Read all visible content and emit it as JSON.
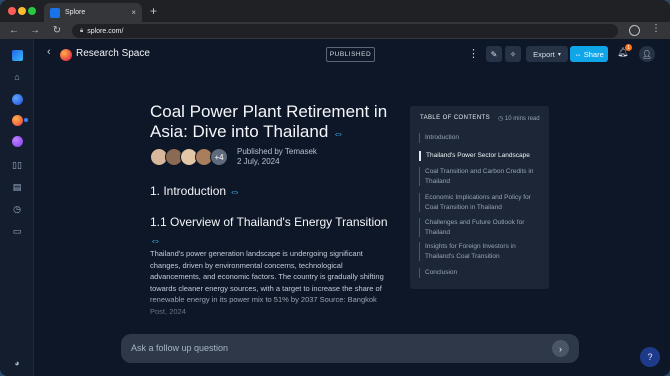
{
  "browser": {
    "tab_title": "Splore",
    "tab_close": "×",
    "new_tab": "+",
    "url": "splore.com/"
  },
  "topbar": {
    "back_icon": "‹",
    "space_title": "Research Space",
    "status": "PUBLISHED",
    "more_icon": "⋮",
    "export_label": "Export",
    "share_label": "Share",
    "notification_count": "1"
  },
  "article": {
    "title": "Coal Power Plant Retirement in Asia: Dive into Thailand",
    "published_by": "Published by Temasek",
    "date": "2 July, 2024",
    "extra_authors": "+4",
    "h2": "1. Introduction",
    "h3": "1.1 Overview of Thailand's Energy Transition",
    "body": "Thailand's power generation landscape is undergoing significant changes, driven by environmental concerns, technological advancements, and economic factors. The country is gradually shifting towards cleaner energy sources, with a target to increase the share of renewable energy in its power mix to 51% by 2037 Source: Bangkok Post, 2024"
  },
  "toc": {
    "heading": "TABLE OF CONTENTS",
    "read_time": "10 mins read",
    "items": [
      {
        "label": "Introduction"
      },
      {
        "label": "Thailand's Power Sector Landscape"
      },
      {
        "label": "Coal Transition and Carbon Credits in Thailand"
      },
      {
        "label": "Economic Implications and Policy for Coal Transition in Thailand"
      },
      {
        "label": "Challenges and Future Outlook for Thailand"
      },
      {
        "label": "Insights for Foreign Investors in Thailand's Coal Transition"
      },
      {
        "label": "Conclusion"
      }
    ]
  },
  "ask": {
    "placeholder": "Ask a follow up question"
  },
  "help": "?"
}
